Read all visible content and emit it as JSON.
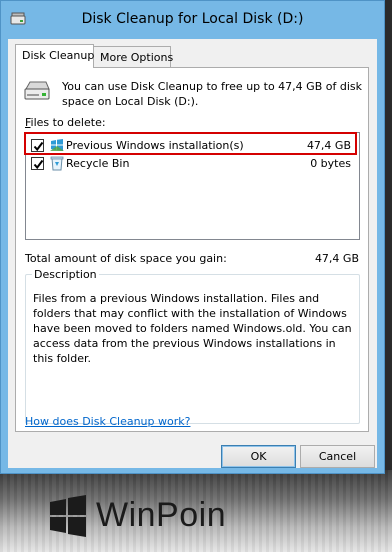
{
  "window": {
    "title": "Disk Cleanup for Local Disk (D:)"
  },
  "tabs": [
    {
      "label": "Disk Cleanup",
      "active": true
    },
    {
      "label": "More Options",
      "active": false
    }
  ],
  "intro": "You can use Disk Cleanup to free up to 47,4 GB of disk space on Local Disk (D:).",
  "files": {
    "label_prefix": "F",
    "label_rest": "iles to delete:",
    "items": [
      {
        "name": "Previous Windows installation(s)",
        "size": "47,4 GB",
        "checked": true,
        "icon": "windows-installation-icon"
      },
      {
        "name": "Recycle Bin",
        "size": "0 bytes",
        "checked": true,
        "icon": "recycle-bin-icon"
      }
    ]
  },
  "total": {
    "label": "Total amount of disk space you gain:",
    "value": "47,4 GB"
  },
  "description": {
    "legend": "Description",
    "text": "Files from a previous Windows installation.  Files and folders that may conflict with the installation of Windows have been moved to folders named Windows.old.  You can access data from the previous Windows installations in this folder."
  },
  "help_link": "How does Disk Cleanup work?",
  "buttons": {
    "ok": "OK",
    "cancel": "Cancel"
  },
  "watermark": {
    "text": "WinPoin"
  },
  "colors": {
    "frame": "#76b8e6",
    "highlight": "#d40000",
    "link": "#0066cc"
  }
}
